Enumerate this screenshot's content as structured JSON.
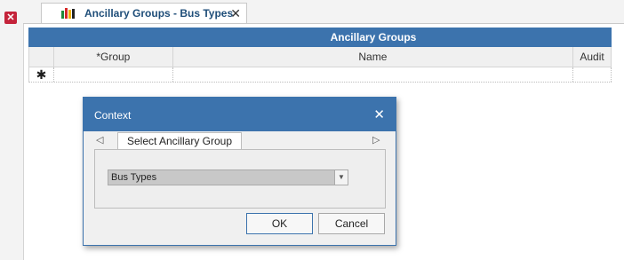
{
  "window": {
    "close_label": "✕"
  },
  "tab": {
    "title": "Ancillary Groups - Bus Types",
    "close_label": "✕",
    "icon": "chart-icon"
  },
  "grid": {
    "title": "Ancillary Groups",
    "columns": [
      "*Group",
      "Name",
      "Audit"
    ],
    "new_row_indicator": "✱"
  },
  "dialog": {
    "title": "Context",
    "close_label": "✕",
    "prev_label": "◁",
    "next_label": "▷",
    "tab_label": "Select Ancillary Group",
    "select_value": "Bus Types",
    "dropdown_label": "▼",
    "ok_label": "OK",
    "cancel_label": "Cancel"
  },
  "colors": {
    "accent": "#3c73ad",
    "close_red": "#c4233a"
  }
}
